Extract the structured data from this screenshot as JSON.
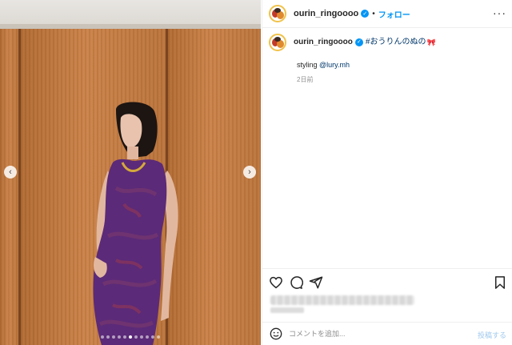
{
  "post": {
    "media": {
      "prev_symbol": "‹",
      "next_symbol": "›",
      "slide_count": 11,
      "active_slide": 5
    },
    "header": {
      "username": "ourin_ringoooo",
      "separator": "•",
      "follow_label": "フォロー",
      "more_symbol": "···"
    },
    "caption": {
      "username": "ourin_ringoooo",
      "hashtag": "#おうりんのぬの",
      "emoji": "🎀",
      "styling_prefix": "styling ",
      "styling_mention": "@lury.mh",
      "timestamp": "2日前"
    },
    "comment": {
      "placeholder": "コメントを追加...",
      "post_label": "投稿する"
    },
    "icons": [
      "heart-icon",
      "comment-icon",
      "share-icon",
      "bookmark-icon",
      "emoji-icon",
      "verified-icon"
    ],
    "colors": {
      "accent": "#0095f6",
      "link": "#00376b",
      "post_disabled": "#9fc8ee"
    }
  }
}
